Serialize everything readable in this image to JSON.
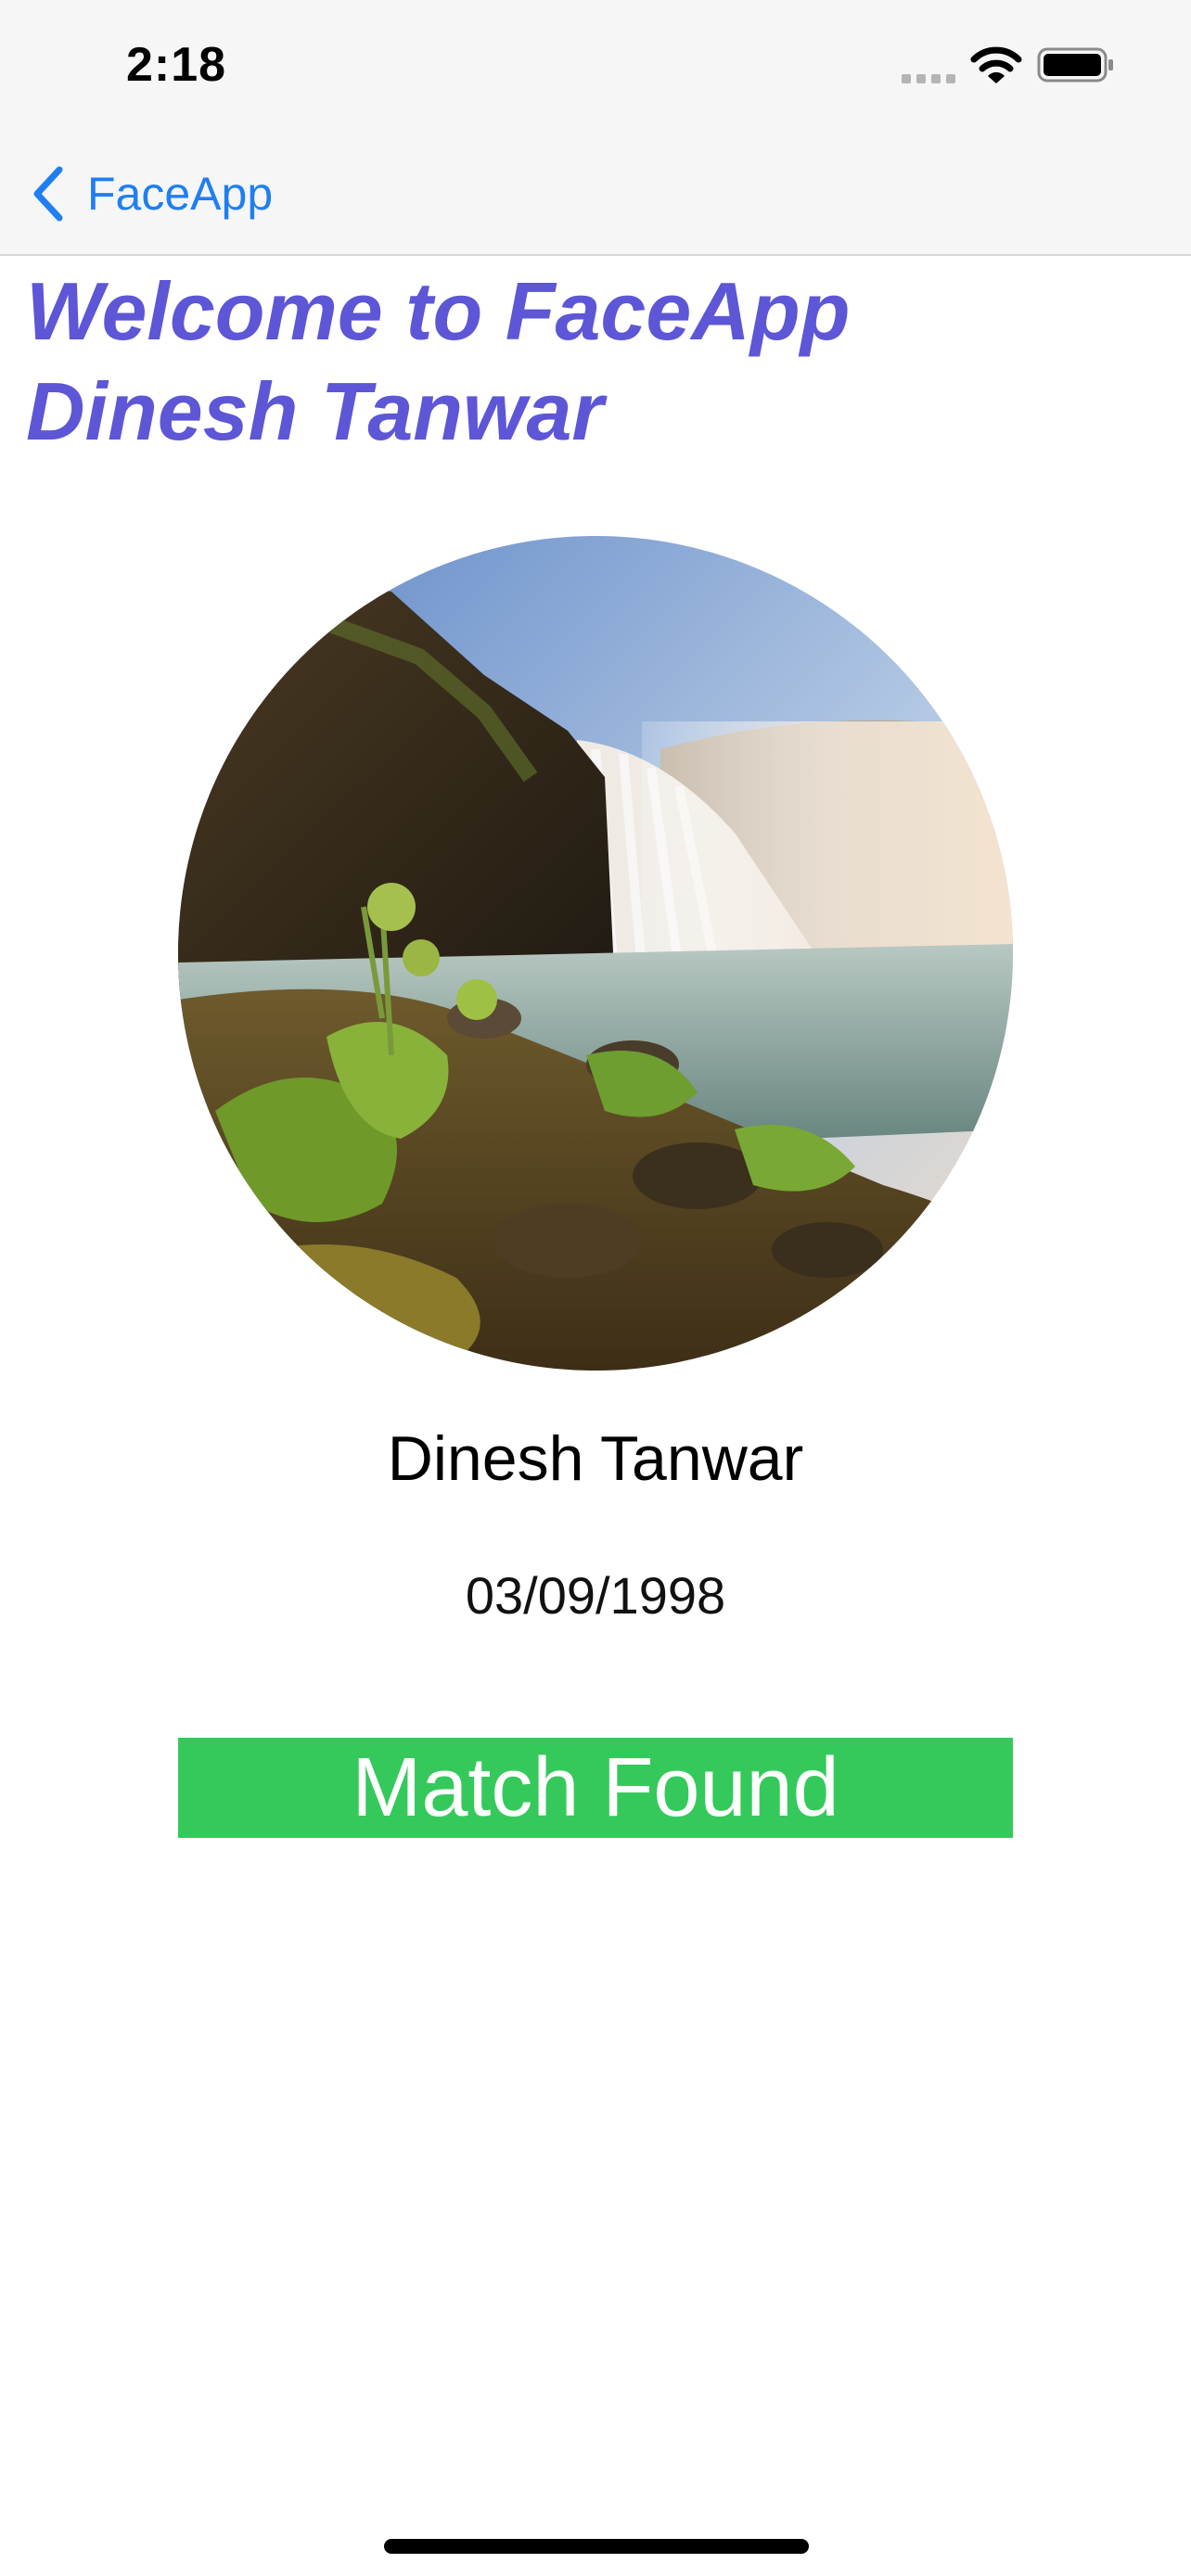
{
  "status_bar": {
    "time": "2:18",
    "icons": [
      "cellular-signal-icon",
      "wifi-icon",
      "battery-icon"
    ]
  },
  "nav": {
    "back_label": "FaceApp",
    "back_icon": "chevron-left-icon"
  },
  "welcome": {
    "line1": "Welcome to FaceApp",
    "line2": "Dinesh Tanwar"
  },
  "profile": {
    "photo_subject": "waterfall-landscape",
    "name": "Dinesh Tanwar",
    "dob": "03/09/1998"
  },
  "match": {
    "label": "Match Found"
  },
  "colors": {
    "accent_blue": "#1f7ff1",
    "title_purple": "#5d56d6",
    "match_green": "#35c95b",
    "bar_background": "#f6f6f6"
  }
}
